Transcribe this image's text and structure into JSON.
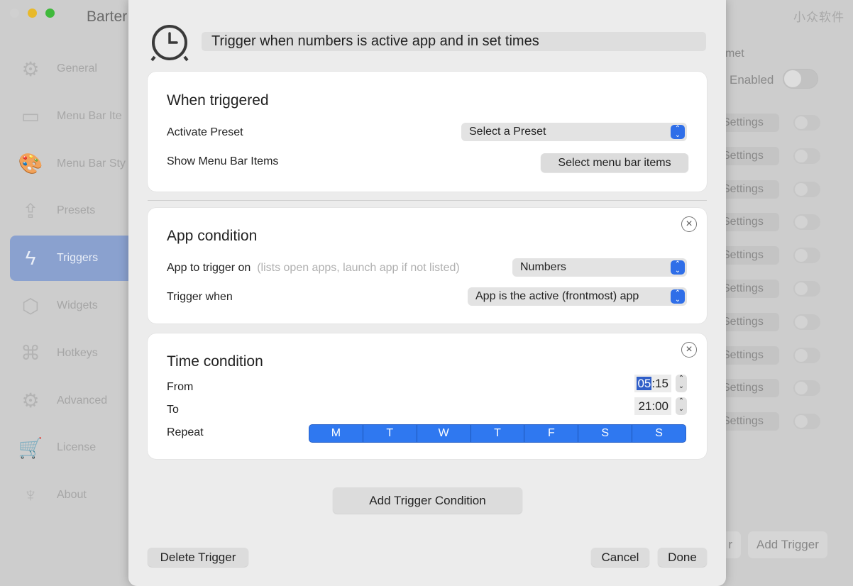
{
  "window": {
    "title": "Barter",
    "watermark": "小众软件"
  },
  "sidebar": {
    "items": [
      {
        "label": "General",
        "icon": "gear-icon",
        "glyph": "⚙"
      },
      {
        "label": "Menu Bar Ite",
        "icon": "window-icon",
        "glyph": "▭"
      },
      {
        "label": "Menu Bar Sty",
        "icon": "palette-icon",
        "glyph": "🎨"
      },
      {
        "label": "Presets",
        "icon": "upload-icon",
        "glyph": "⇪"
      },
      {
        "label": "Triggers",
        "icon": "lightning-icon",
        "glyph": "ϟ",
        "active": true
      },
      {
        "label": "Widgets",
        "icon": "cube-icon",
        "glyph": "⬡"
      },
      {
        "label": "Hotkeys",
        "icon": "command-icon",
        "glyph": "⌘"
      },
      {
        "label": "Advanced",
        "icon": "gears-icon",
        "glyph": "⚙"
      },
      {
        "label": "License",
        "icon": "cart-icon",
        "glyph": "🛒"
      },
      {
        "label": "About",
        "icon": "tuxedo-icon",
        "glyph": "♆"
      }
    ]
  },
  "right_panel": {
    "heading": "met",
    "enabled_label": "Enabled",
    "settings_label": "Settings",
    "settings_count": 10,
    "bottom_left_btn": "r",
    "add_trigger": "Add Trigger"
  },
  "sheet": {
    "title": "Trigger when numbers is active app and in set times",
    "when_triggered": {
      "heading": "When triggered",
      "activate_preset_label": "Activate Preset",
      "preset_value": "Select a Preset",
      "show_items_label": "Show Menu Bar Items",
      "select_items_btn": "Select menu bar items"
    },
    "app_condition": {
      "heading": "App condition",
      "app_label": "App to trigger on",
      "app_hint": "(lists open apps, launch app if not listed)",
      "app_value": "Numbers",
      "when_label": "Trigger when",
      "when_value": "App is the active (frontmost) app"
    },
    "time_condition": {
      "heading": "Time condition",
      "from_label": "From",
      "from_hour": "05",
      "from_rest": ":15",
      "to_label": "To",
      "to_value": "21:00",
      "repeat_label": "Repeat",
      "days": [
        "M",
        "T",
        "W",
        "T",
        "F",
        "S",
        "S"
      ],
      "days_selected": [
        true,
        true,
        true,
        true,
        true,
        true,
        true
      ],
      "accent": "#2f78f0"
    },
    "add_condition": "Add Trigger Condition",
    "delete": "Delete Trigger",
    "cancel": "Cancel",
    "done": "Done"
  }
}
